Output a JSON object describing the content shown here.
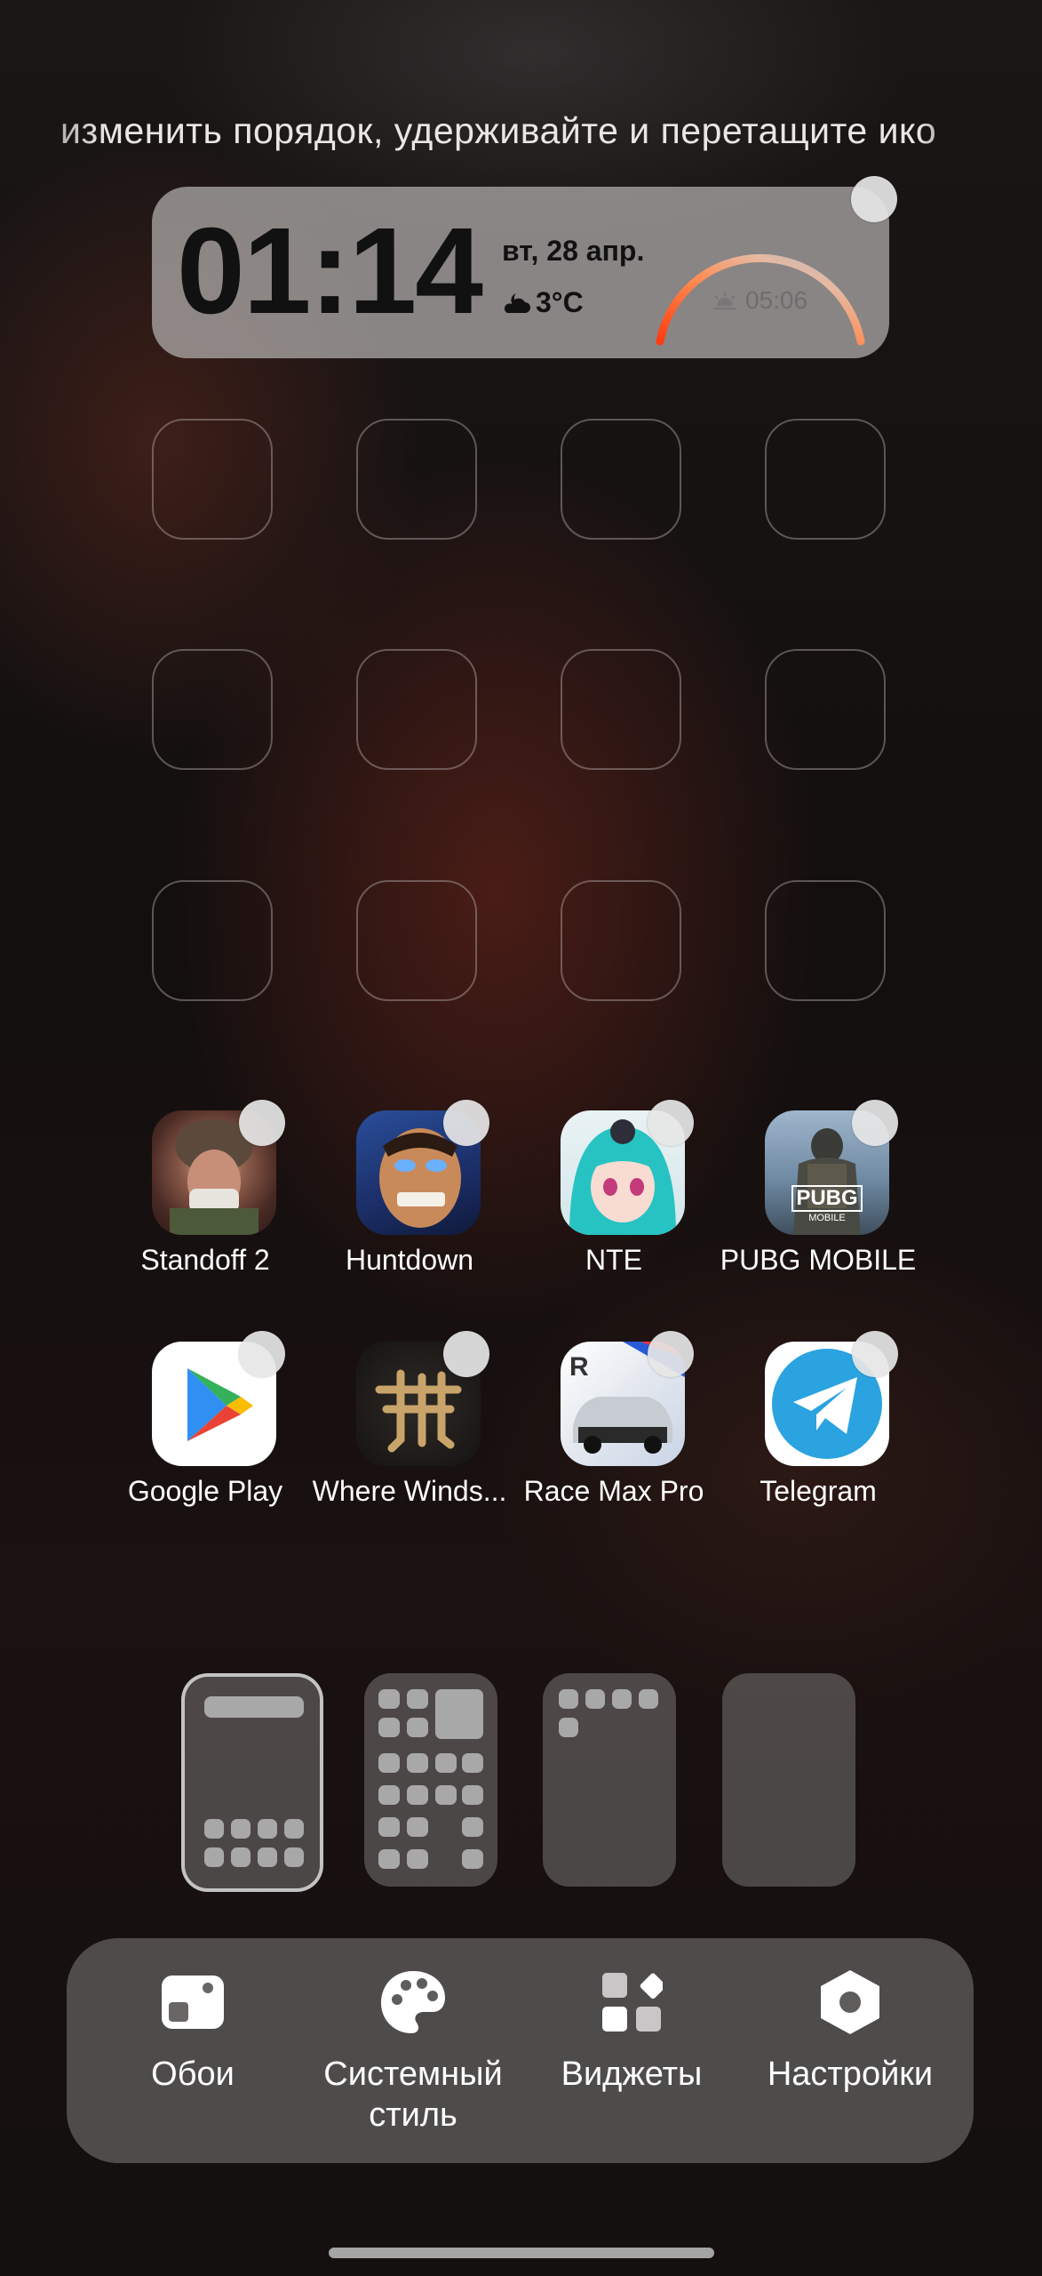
{
  "hint_text": "изменить порядок, удерживайте и перетащите ико",
  "widget": {
    "time": "01:14",
    "date": "вт, 28 апр.",
    "temperature": "3°C",
    "weather_icon": "cloudy-night-icon",
    "sunrise_icon": "sunrise-icon",
    "sunrise_time": "05:06",
    "arc_colors": [
      "#ff4a1c",
      "#ff9a5a",
      "#d6cdc8"
    ]
  },
  "apps": [
    {
      "label": "Standoff 2",
      "icon": "standoff2-icon"
    },
    {
      "label": "Huntdown",
      "icon": "huntdown-icon"
    },
    {
      "label": "NTE",
      "icon": "nte-icon"
    },
    {
      "label": "PUBG MOBILE",
      "icon": "pubg-mobile-icon"
    },
    {
      "label": "Google Play",
      "icon": "google-play-icon"
    },
    {
      "label": "Where Winds...",
      "icon": "where-winds-meet-icon"
    },
    {
      "label": "Race Max Pro",
      "icon": "race-max-pro-icon"
    },
    {
      "label": "Telegram",
      "icon": "telegram-icon"
    }
  ],
  "pubg_icon_text": [
    "PUBG",
    "MOBILE"
  ],
  "toolbar": {
    "wallpapers": "Обои",
    "system_style": "Системный стиль",
    "widgets": "Виджеты",
    "settings": "Настройки"
  },
  "colors": {
    "widget_bg": "#b4b2b0",
    "toolbar_bg": "#5f5c5c",
    "arc_start": "#ff4a1c",
    "telegram": "#2aa3e0"
  }
}
